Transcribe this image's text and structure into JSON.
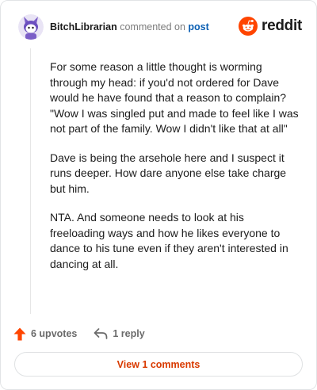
{
  "header": {
    "username": "BitchLibrarian",
    "action_text": "commented on",
    "post_link": "post"
  },
  "brand": {
    "wordmark": "reddit",
    "logo_icon": "reddit-logo-icon",
    "color": "#ff4500"
  },
  "comment": {
    "paragraphs": [
      "For some reason a little thought is worming through my head: if you'd not ordered for Dave would he have found that a reason to complain? \"Wow I was singled put and made to feel like I was not part of the family. Wow I didn't like that at all\"",
      "Dave is being the arsehole here and I suspect it runs deeper. How dare anyone else take charge but him.",
      "NTA. And someone needs to look at his freeloading ways and how he likes everyone to dance to his tune even if they aren't interested in dancing at all."
    ]
  },
  "actions": {
    "upvotes_label": "6 upvotes",
    "upvote_icon": "upvote-arrow-icon",
    "upvote_color": "#ff4500",
    "reply_label": "1 reply",
    "reply_icon": "reply-arrow-icon"
  },
  "footer": {
    "view_comments_label": "View 1 comments",
    "accent_color": "#d93a00"
  }
}
